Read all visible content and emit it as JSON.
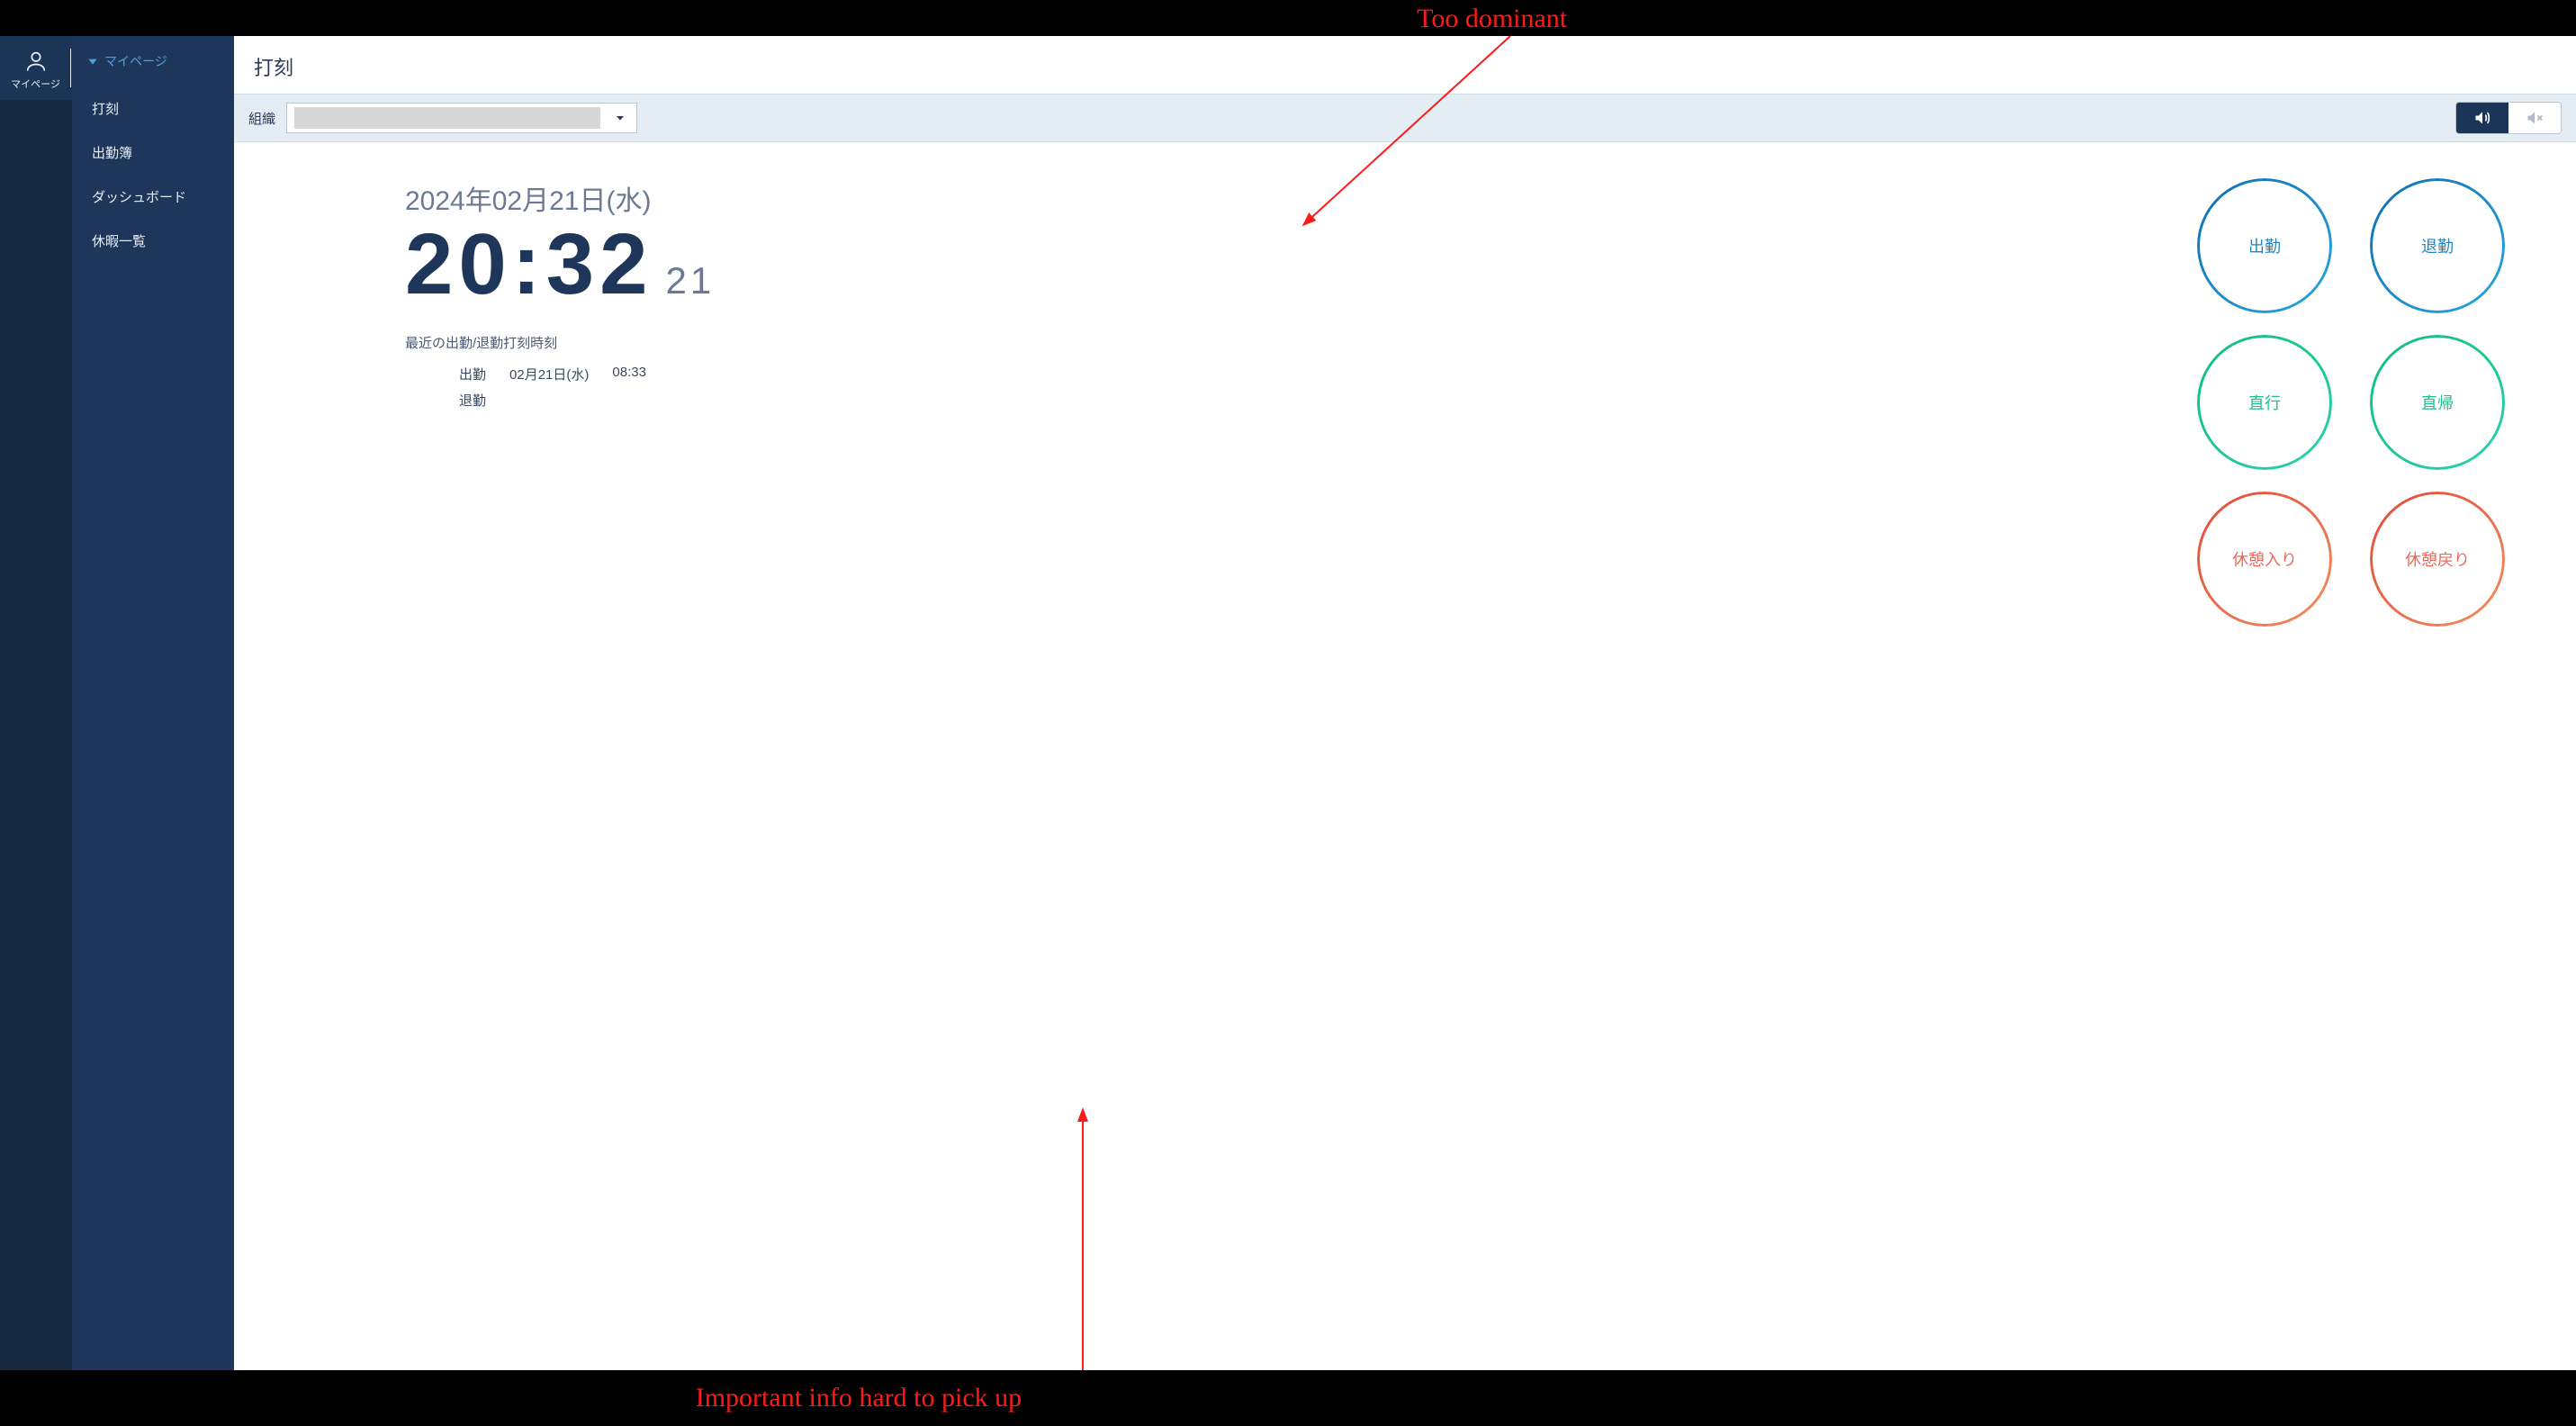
{
  "sidebar_narrow": {
    "mypage_label": "マイページ"
  },
  "sidebar_wide": {
    "header": "マイページ",
    "items": [
      "打刻",
      "出勤簿",
      "ダッシュボード",
      "休暇一覧"
    ]
  },
  "page": {
    "title": "打刻"
  },
  "filter": {
    "org_label": "組織"
  },
  "clock": {
    "date": "2024年02月21日(水)",
    "time": "20:32",
    "seconds": "21",
    "recent_header": "最近の出勤/退勤打刻時刻",
    "rows": [
      {
        "label": "出勤",
        "date": "02月21日(水)",
        "time": "08:33"
      },
      {
        "label": "退勤",
        "date": "",
        "time": ""
      }
    ]
  },
  "buttons": {
    "checkin": "出勤",
    "checkout": "退勤",
    "direct_go": "直行",
    "direct_return": "直帰",
    "break_start": "休憩入り",
    "break_end": "休憩戻り"
  },
  "annotations": {
    "top": "Too dominant",
    "bottom": "Important info hard to pick up"
  }
}
